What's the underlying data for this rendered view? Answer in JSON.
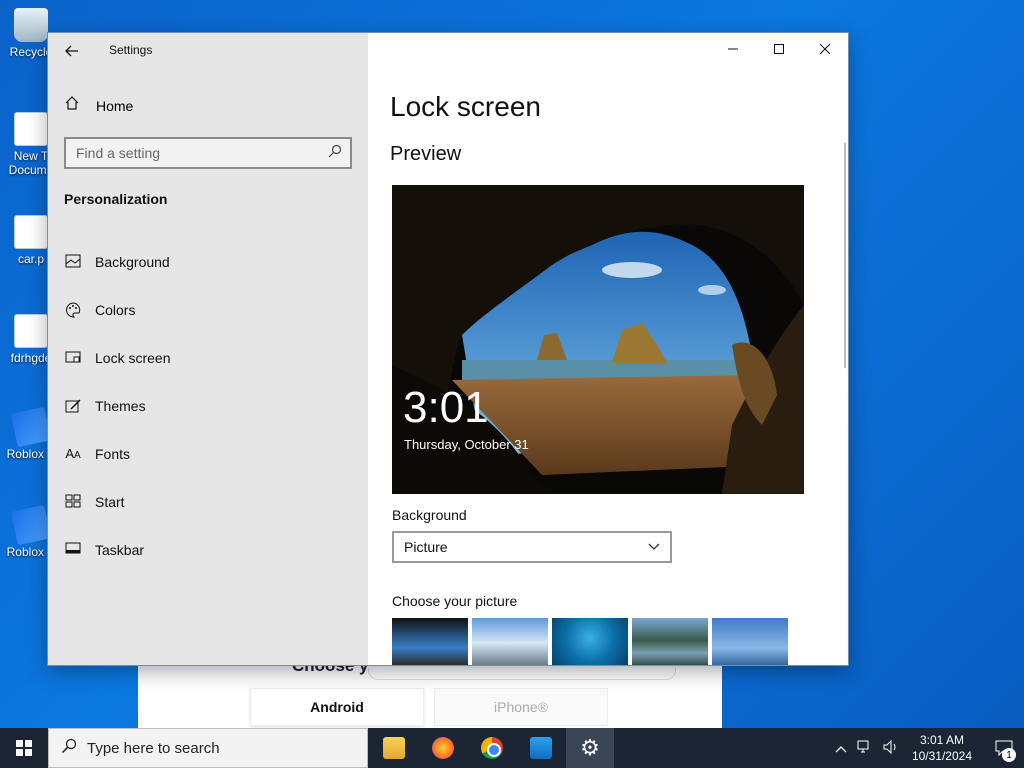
{
  "desktop": {
    "icons": [
      {
        "label": "Recycle",
        "icon": "recycle-bin-icon"
      },
      {
        "label": "New T Docume",
        "icon": "document-icon"
      },
      {
        "label": "car.p",
        "icon": "image-file-icon"
      },
      {
        "label": "fdrhgde",
        "icon": "image-file-icon"
      },
      {
        "label": "Roblox S",
        "icon": "roblox-studio-icon"
      },
      {
        "label": "Roblox P",
        "icon": "roblox-player-icon"
      }
    ]
  },
  "background_app": {
    "title": "Choose y",
    "android_label": "Android",
    "iphone_label": "iPhone®"
  },
  "settings": {
    "app_title": "Settings",
    "home_label": "Home",
    "search_placeholder": "Find a setting",
    "section": "Personalization",
    "nav": [
      {
        "label": "Background",
        "icon": "picture-icon"
      },
      {
        "label": "Colors",
        "icon": "palette-icon"
      },
      {
        "label": "Lock screen",
        "icon": "lock-screen-icon"
      },
      {
        "label": "Themes",
        "icon": "brush-icon"
      },
      {
        "label": "Fonts",
        "icon": "font-icon"
      },
      {
        "label": "Start",
        "icon": "start-icon"
      },
      {
        "label": "Taskbar",
        "icon": "taskbar-icon"
      }
    ],
    "page_title": "Lock screen",
    "preview_heading": "Preview",
    "preview_time": "3:01",
    "preview_date": "Thursday, October 31",
    "background_label": "Background",
    "background_value": "Picture",
    "choose_picture_label": "Choose your picture"
  },
  "taskbar": {
    "search_placeholder": "Type here to search",
    "apps": [
      "file-explorer-icon",
      "firefox-icon",
      "chrome-icon",
      "store-icon",
      "settings-gear-icon"
    ],
    "time": "3:01 AM",
    "date": "10/31/2024",
    "notification_count": "1"
  }
}
